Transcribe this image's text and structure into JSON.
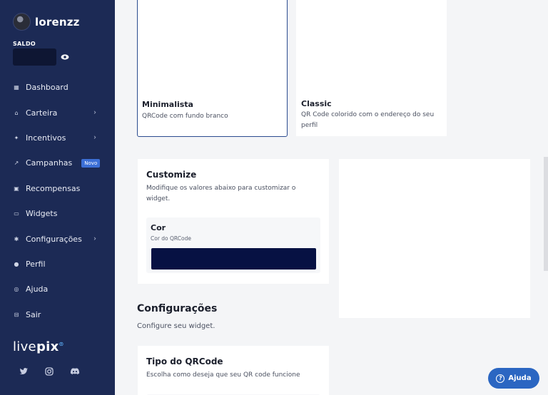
{
  "sidebar": {
    "username": "lorenzz",
    "saldo_label": "SALDO",
    "items": [
      {
        "label": "Dashboard",
        "icon": "dashboard-icon"
      },
      {
        "label": "Carteira",
        "icon": "bank-icon",
        "chevron": true
      },
      {
        "label": "Incentivos",
        "icon": "sparkle-icon",
        "chevron": true
      },
      {
        "label": "Campanhas",
        "icon": "chart-icon",
        "badge": "Novo"
      },
      {
        "label": "Recompensas",
        "icon": "gift-icon"
      },
      {
        "label": "Widgets",
        "icon": "widget-icon"
      },
      {
        "label": "Configurações",
        "icon": "gear-icon",
        "chevron": true
      },
      {
        "label": "Perfil",
        "icon": "user-icon"
      },
      {
        "label": "Ajuda",
        "icon": "help-icon"
      },
      {
        "label": "Sair",
        "icon": "logout-icon"
      }
    ],
    "logo_light": "live",
    "logo_bold": "pix",
    "logo_mark": "⊚"
  },
  "styles": {
    "minimalista": {
      "title": "Minimalista",
      "desc": "QRCode com fundo branco"
    },
    "classic": {
      "title": "Classic",
      "desc": "QR Code colorido com o endereço do seu perfil"
    }
  },
  "customize": {
    "title": "Customize",
    "desc": "Modifique os valores abaixo para customizar o widget.",
    "cor_title": "Cor",
    "cor_sub": "Cor do QRCode",
    "color_value": "#071143"
  },
  "configuracoes": {
    "title": "Configurações",
    "desc": "Configure seu widget."
  },
  "tipo": {
    "title": "Tipo do QRCode",
    "desc": "Escolha como deseja que seu QR code funcione"
  },
  "help_button": "Ajuda"
}
